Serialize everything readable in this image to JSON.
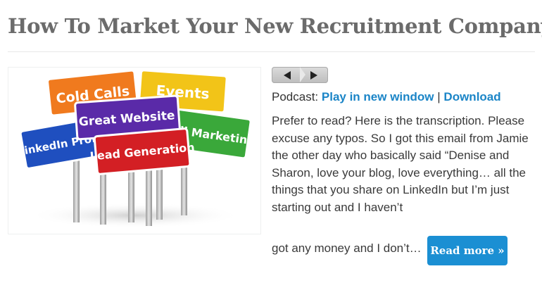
{
  "post": {
    "title": "How To Market Your New Recruitment Company"
  },
  "thumbnail": {
    "signs": {
      "cold_calls": "Cold Calls",
      "events": "Events",
      "great_website": "Great Website",
      "email_marketing": "Email Marketing",
      "linkedin": "LinkedIn Profile",
      "lead_generation": "Lead Generation"
    }
  },
  "player": {
    "back_icon": "play-back-icon",
    "forward_icon": "play-forward-icon"
  },
  "podcast": {
    "label": "Podcast:",
    "play_link": "Play in new window",
    "separator": "|",
    "download_link": "Download"
  },
  "excerpt": {
    "text": "Prefer to read? Here is the transcription. Please excuse any typos.   So I got this email from Jamie the other day who basically said “Denise and Sharon, love your blog, love everything… all the things that you share on LinkedIn but I’m just starting out and I haven’t",
    "tail": "got any money and I don’t…"
  },
  "read_more": {
    "label": "Read more »"
  },
  "colors": {
    "title": "#6b6b6b",
    "link": "#1b85c7",
    "button": "#1b8fd3"
  }
}
